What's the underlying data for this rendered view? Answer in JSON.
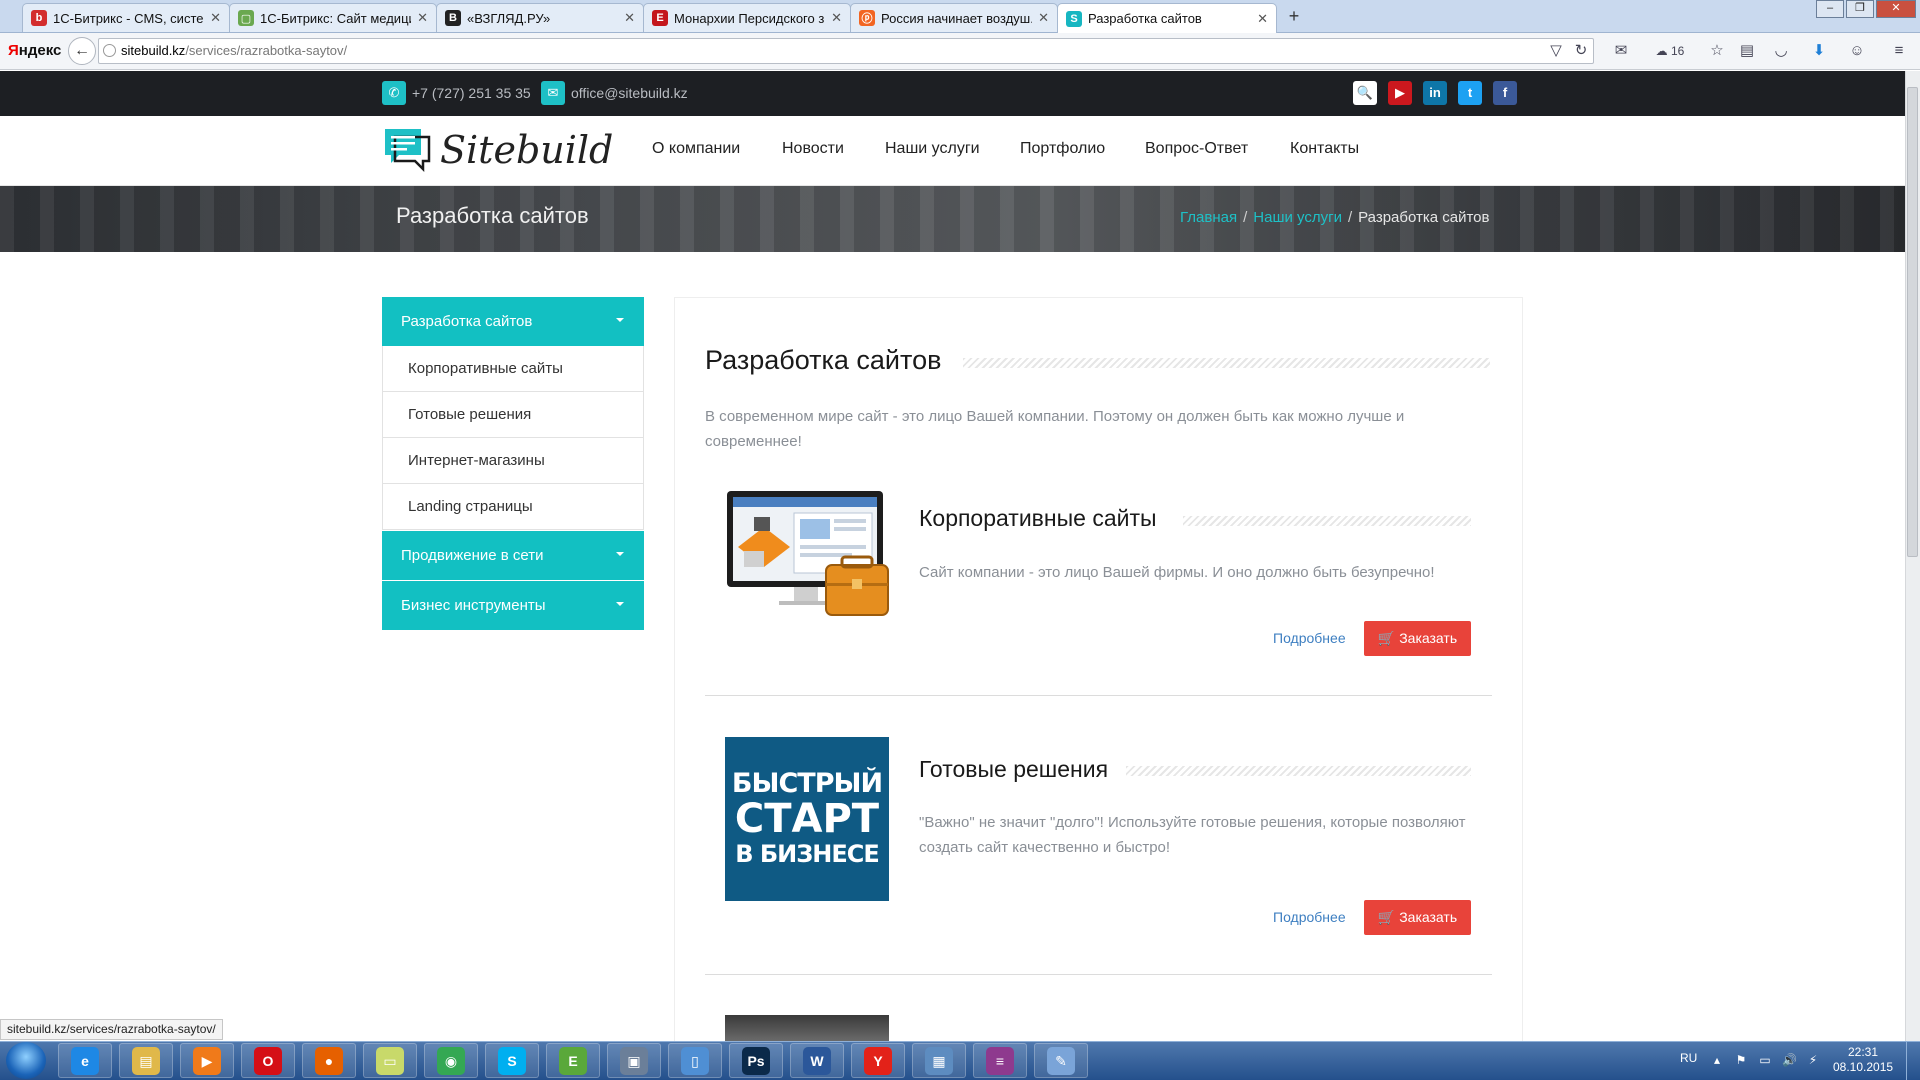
{
  "browser": {
    "tabs": [
      {
        "title": "1С-Битрикс - CMS, систе...",
        "icon_color": "#d32d2d",
        "icon_glyph": "b"
      },
      {
        "title": "1С-Битрикс: Сайт медици...",
        "icon_color": "#6aa84f",
        "icon_glyph": "▢"
      },
      {
        "title": "«ВЗГЛЯД.РУ»",
        "icon_color": "#222222",
        "icon_glyph": "В"
      },
      {
        "title": "Монархии Персидского з...",
        "icon_color": "#c4161c",
        "icon_glyph": "Е"
      },
      {
        "title": "Россия начинает воздуш...",
        "icon_color": "#f26522",
        "icon_glyph": "ⓟ"
      },
      {
        "title": "Разработка сайтов",
        "icon_color": "#17b6c1",
        "icon_glyph": "S"
      }
    ],
    "new_tab": "+",
    "yandex": {
      "first": "Я",
      "rest": "ндекс"
    },
    "url_domain": "sitebuild.kz",
    "url_path": "/services/razrabotka-saytov/",
    "weather": "16",
    "status_link": "sitebuild.kz/services/razrabotka-saytov/"
  },
  "site": {
    "phone": "+7 (727) 251 35 35",
    "email": "office@sitebuild.kz",
    "social": [
      {
        "name": "search-icon",
        "glyph": "🔍",
        "color": "#ffffff"
      },
      {
        "name": "youtube-icon",
        "glyph": "▶",
        "color": "#cc181e"
      },
      {
        "name": "linkedin-icon",
        "glyph": "in",
        "color": "#0e76a8"
      },
      {
        "name": "twitter-icon",
        "glyph": "t",
        "color": "#1da1f2"
      },
      {
        "name": "facebook-icon",
        "glyph": "f",
        "color": "#3b5998"
      }
    ],
    "logo_text": "Sitebuild",
    "nav": [
      "О компании",
      "Новости",
      "Наши услуги",
      "Портфолио",
      "Вопрос-Ответ",
      "Контакты"
    ],
    "banner_title": "Разработка сайтов",
    "breadcrumb": {
      "home": "Главная",
      "section": "Наши услуги",
      "current": "Разработка сайтов"
    },
    "sidebar": {
      "open_section": "Разработка сайтов",
      "sub_items": [
        "Корпоративные сайты",
        "Готовые решения",
        "Интернет-магазины",
        "Landing страницы"
      ],
      "other_sections": [
        "Продвижение в сети",
        "Бизнес инструменты"
      ]
    },
    "content": {
      "title": "Разработка сайтов",
      "intro": "В современном мире сайт - это лицо Вашей компании. Поэтому он должен быть как можно лучше и современнее!",
      "services": [
        {
          "title": "Корпоративные сайты",
          "desc": "Сайт компании - это лицо Вашей фирмы. И оно должно быть безупречно!",
          "more": "Подробнее",
          "order": "Заказать"
        },
        {
          "title": "Готовые решения",
          "desc": "\"Важно\" не значит \"долго\"! Используйте готовые решения, которые позволяют создать сайт качественно и быстро!",
          "more": "Подробнее",
          "order": "Заказать",
          "image_text": [
            "БЫСТРЫЙ",
            "СТАРТ",
            "В БИЗНЕСЕ"
          ]
        }
      ],
      "accent_color": "#12c0c2",
      "order_color": "#e8433a"
    }
  },
  "taskbar": {
    "lang": "RU",
    "time": "22:31",
    "date": "08.10.2015",
    "apps": [
      {
        "name": "ie-icon",
        "glyph": "e",
        "color": "#1e88e5"
      },
      {
        "name": "explorer-icon",
        "glyph": "▤",
        "color": "#e0b84a"
      },
      {
        "name": "media-player-icon",
        "glyph": "▶",
        "color": "#f07a1a"
      },
      {
        "name": "opera-icon",
        "glyph": "O",
        "color": "#d50f16"
      },
      {
        "name": "firefox-icon",
        "glyph": "●",
        "color": "#e66000"
      },
      {
        "name": "folder-icon",
        "glyph": "▭",
        "color": "#c8d96a"
      },
      {
        "name": "chrome-icon",
        "glyph": "◉",
        "color": "#34a853"
      },
      {
        "name": "skype-icon",
        "glyph": "S",
        "color": "#00aff0"
      },
      {
        "name": "evernote-icon",
        "glyph": "E",
        "color": "#5aa83a"
      },
      {
        "name": "network-icon",
        "glyph": "▣",
        "color": "#6b7f99"
      },
      {
        "name": "book-icon",
        "glyph": "▯",
        "color": "#4f8fd4"
      },
      {
        "name": "photoshop-icon",
        "glyph": "Ps",
        "color": "#0b2a4a"
      },
      {
        "name": "word-icon",
        "glyph": "W",
        "color": "#2b579a"
      },
      {
        "name": "yandex-browser-icon",
        "glyph": "Y",
        "color": "#e32219"
      },
      {
        "name": "remote-desktop-icon",
        "glyph": "▦",
        "color": "#5d8cc0"
      },
      {
        "name": "winrar-icon",
        "glyph": "≡",
        "color": "#8e3a8e"
      },
      {
        "name": "paint-icon",
        "glyph": "✎",
        "color": "#7aa4d8"
      }
    ]
  }
}
